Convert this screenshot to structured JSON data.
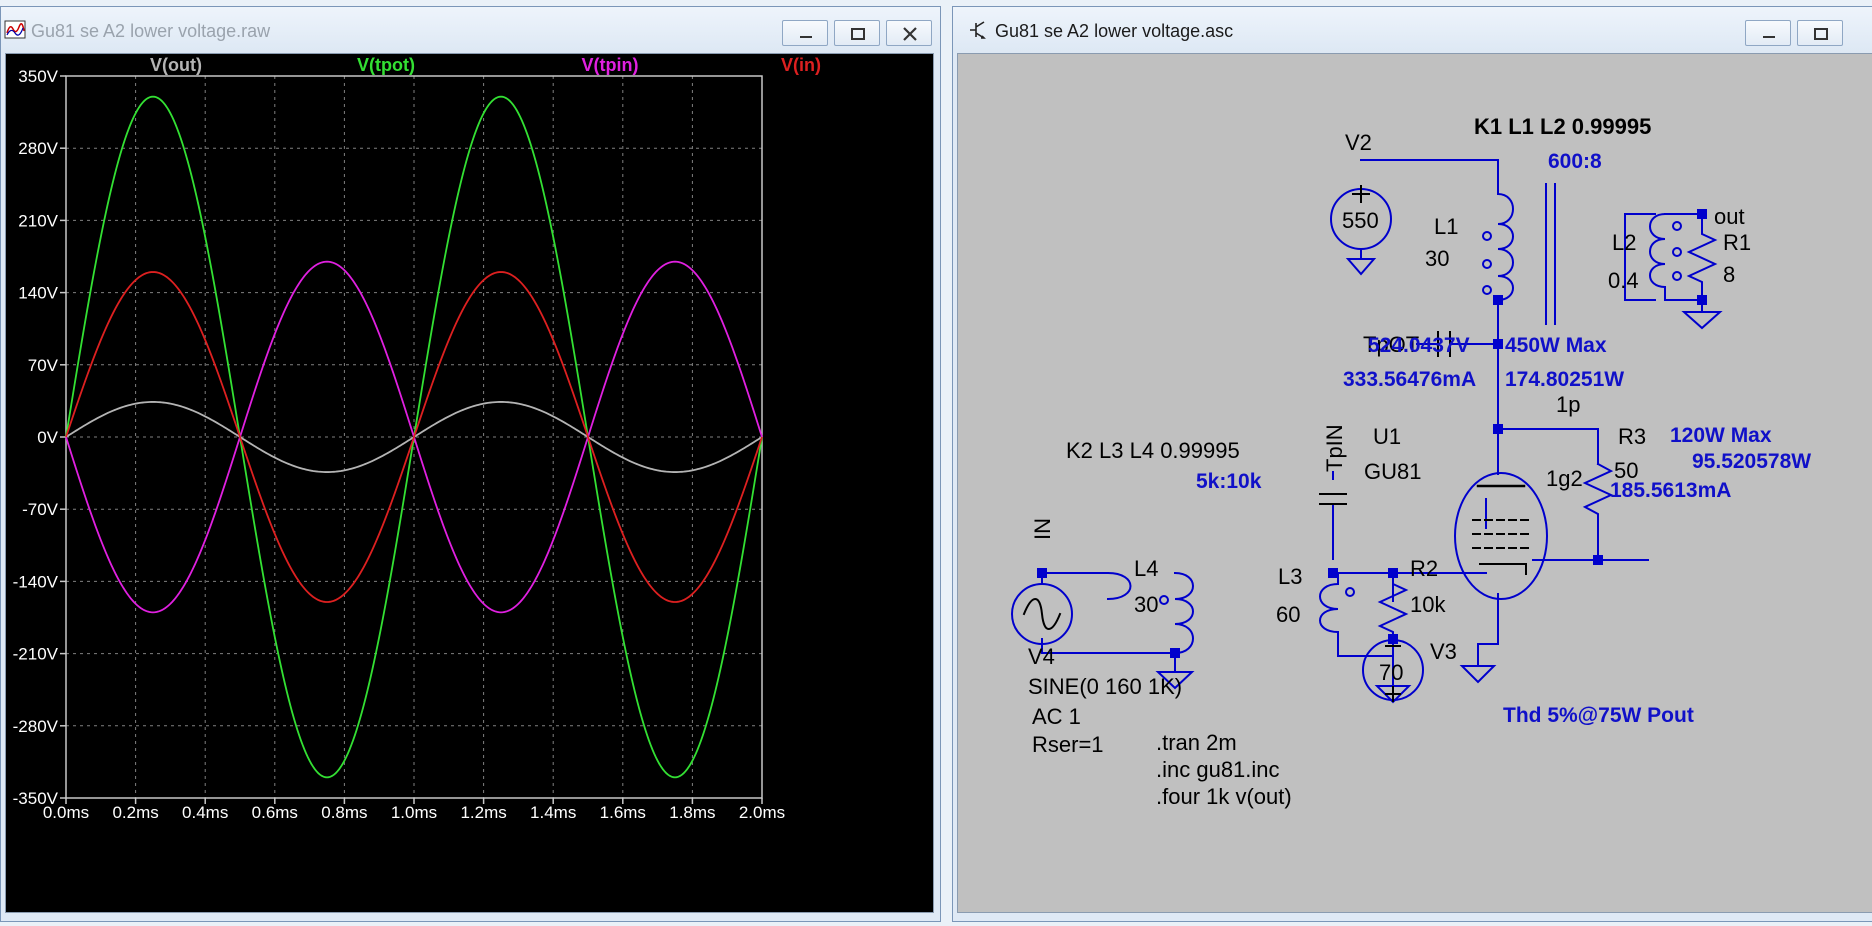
{
  "left_window": {
    "title": "Gu81 se A2 lower voltage.raw",
    "controls": [
      "minimize",
      "maximize",
      "close"
    ]
  },
  "right_window": {
    "title": "Gu81 se A2 lower voltage.asc",
    "controls": [
      "minimize",
      "maximize"
    ]
  },
  "chart_data": {
    "type": "line",
    "y_ticks": [
      "350V",
      "280V",
      "210V",
      "140V",
      "70V",
      "0V",
      "-70V",
      "-140V",
      "-210V",
      "-280V",
      "-350V"
    ],
    "x_ticks": [
      "0.0ms",
      "0.2ms",
      "0.4ms",
      "0.6ms",
      "0.8ms",
      "1.0ms",
      "1.2ms",
      "1.4ms",
      "1.6ms",
      "1.8ms",
      "2.0ms"
    ],
    "xlim": [
      0,
      2.0
    ],
    "ylim": [
      -350,
      350
    ],
    "grid": true,
    "background": "#000000",
    "series": [
      {
        "name": "V(out)",
        "color": "#b4b4b4",
        "amplitude": 34,
        "sign": 1,
        "freq_khz": 1
      },
      {
        "name": "V(tpot)",
        "color": "#33e033",
        "amplitude": 330,
        "sign": 1,
        "freq_khz": 1
      },
      {
        "name": "V(tpin)",
        "color": "#e020e0",
        "amplitude": 170,
        "sign": -1,
        "freq_khz": 1
      },
      {
        "name": "V(in)",
        "color": "#dd2020",
        "amplitude": 160,
        "sign": 1,
        "freq_khz": 1
      }
    ]
  },
  "schematic": {
    "v2_name": "V2",
    "v2_value": "550",
    "k1": "K1 L1 L2 0.99995",
    "ratio1": "600:8",
    "l1_name": "L1",
    "l1_value": "30",
    "l2_name": "L2",
    "l2_value": "0.4",
    "out_label": "out",
    "r1_name": "R1",
    "r1_value": "8",
    "tpot": "TpOT",
    "plate_v": "524.0437V",
    "plate_max": "450W Max",
    "plate_i": "333.56476mA",
    "plate_p": "174.80251W",
    "c1p": "1p",
    "r3_name": "R3",
    "r3_value": "50",
    "g2_max": "120W Max",
    "g2_p": "95.520578W",
    "g2_i": "185.5613mA",
    "g2_pin": "1g2",
    "tpin": "TpIN",
    "u1_name": "U1",
    "u1_value": "GU81",
    "k2": "K2  L3 L4 0.99995",
    "ratio2": "5k:10k",
    "in_label": "IN",
    "l4_name": "L4",
    "l4_value": "30",
    "l3_name": "L3",
    "l3_value": "60",
    "r2_name": "R2",
    "r2_value": "10k",
    "v3_name": "V3",
    "v3_value": "70",
    "v4_name": "V4",
    "v4_sine": "SINE(0 160 1K)",
    "v4_ac": "AC 1",
    "v4_rser": "Rser=1",
    "tran": ".tran 2m",
    "inc": ".inc gu81.inc",
    "four": ".four 1k v(out)",
    "thd": "Thd 5%@75W Pout"
  }
}
